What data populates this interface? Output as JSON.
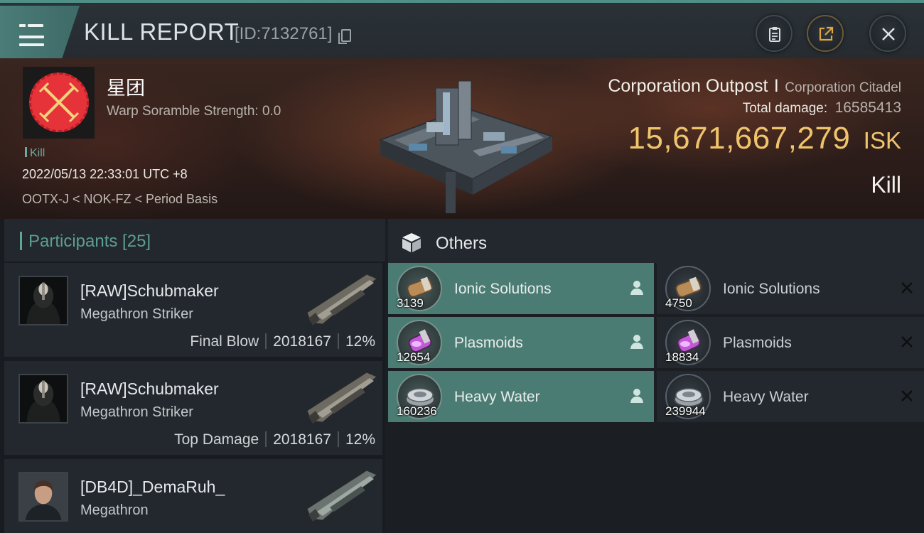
{
  "header": {
    "title": "KILL REPORT",
    "report_id": "[ID:7132761]",
    "icons": {
      "menu": "hamburger-menu-icon",
      "copy": "copy-icon",
      "clipboard": "clipboard-icon",
      "share": "share-icon",
      "close": "close-icon"
    }
  },
  "victim": {
    "corp_name": "星团",
    "warp_scramble": "Warp Soramble Strength: 0.0",
    "kill_tag": "Kill",
    "date": "2022/05/13 22:33:01 UTC +8",
    "location": "OOTX-J < NOK-FZ < Period Basis",
    "colors": {
      "logo_red": "#e6333a",
      "logo_cross": "#f2d27a"
    }
  },
  "target": {
    "name": "Corporation Outpost",
    "separator": "I",
    "type": "Corporation Citadel",
    "damage_label": "Total damage:",
    "damage_value": "16585413",
    "isk_value": "15,671,667,279",
    "isk_unit": "ISK",
    "result": "Kill",
    "colors": {
      "isk": "#f0c46c"
    }
  },
  "participants": {
    "title": "Participants [25]",
    "list": [
      {
        "name": "[RAW]Schubmaker",
        "ship": "Megathron Striker",
        "role": "Final Blow",
        "damage": "2018167",
        "percent": "12%"
      },
      {
        "name": "[RAW]Schubmaker",
        "ship": "Megathron Striker",
        "role": "Top Damage",
        "damage": "2018167",
        "percent": "12%"
      },
      {
        "name": "[DB4D]_DemaRuh_",
        "ship": "Megathron",
        "role": "",
        "damage": "",
        "percent": ""
      }
    ]
  },
  "others": {
    "title": "Others",
    "items": [
      {
        "name": "Ionic Solutions",
        "qty": "3139",
        "status": "dropped",
        "icon": "canister-icon"
      },
      {
        "name": "Ionic Solutions",
        "qty": "4750",
        "status": "destroyed",
        "icon": "canister-icon"
      },
      {
        "name": "Plasmoids",
        "qty": "12654",
        "status": "dropped",
        "icon": "plasmoid-jar-icon"
      },
      {
        "name": "Plasmoids",
        "qty": "18834",
        "status": "destroyed",
        "icon": "plasmoid-jar-icon"
      },
      {
        "name": "Heavy Water",
        "qty": "160236",
        "status": "dropped",
        "icon": "heavy-water-icon"
      },
      {
        "name": "Heavy Water",
        "qty": "239944",
        "status": "destroyed",
        "icon": "heavy-water-icon"
      }
    ],
    "colors": {
      "dropped": "#4b7c73",
      "destroyed": "#22282d"
    }
  }
}
